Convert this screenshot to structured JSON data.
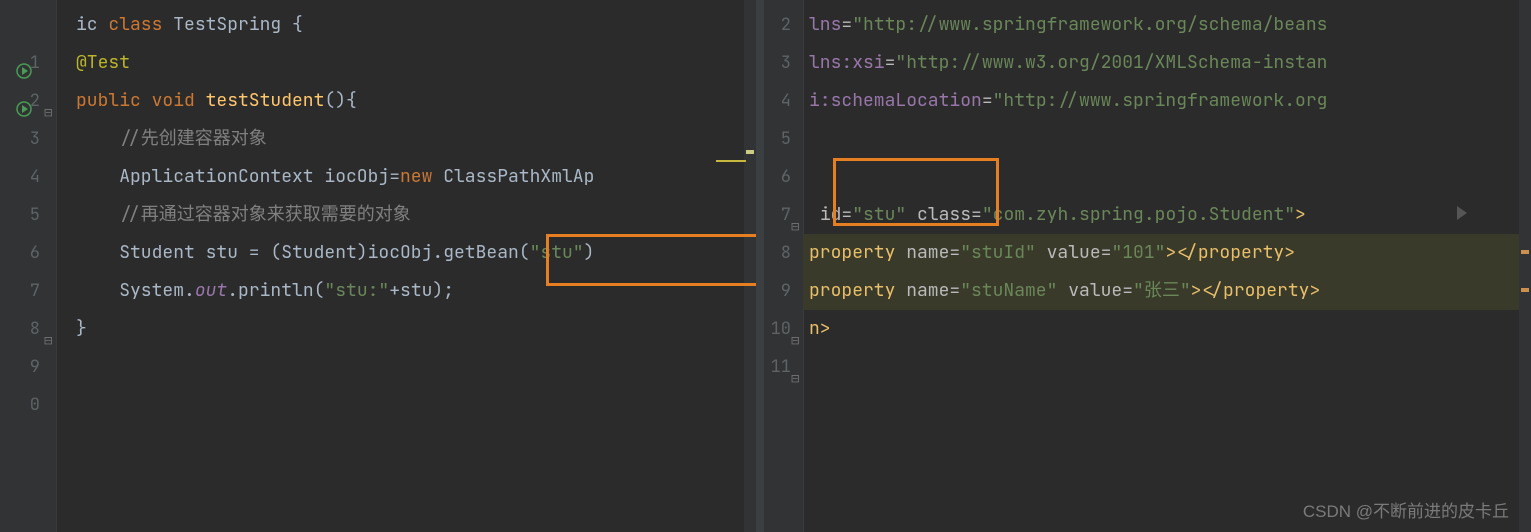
{
  "left": {
    "lines": [
      {
        "n": "",
        "segs": [
          [
            "id",
            "ic "
          ],
          [
            "kw",
            "class "
          ],
          [
            "id",
            "TestSpring {"
          ]
        ]
      },
      {
        "n": "1",
        "run": true,
        "segs": [
          [
            "ann",
            "@Test"
          ]
        ]
      },
      {
        "n": "2",
        "run": true,
        "fold": true,
        "segs": [
          [
            "kw",
            "public void "
          ],
          [
            "method",
            "testStudent"
          ],
          [
            "id",
            "(){"
          ]
        ]
      },
      {
        "n": "3",
        "segs": [
          [
            "id",
            "    "
          ],
          [
            "cmt",
            "//先创建容器对象"
          ]
        ]
      },
      {
        "n": "4",
        "segs": [
          [
            "id",
            "    ApplicationContext iocObj="
          ],
          [
            "kw",
            "new "
          ],
          [
            "id",
            "ClassPathXmlAp"
          ]
        ]
      },
      {
        "n": "5",
        "segs": [
          [
            "id",
            "    "
          ],
          [
            "cmt",
            "//再通过容器对象来获取需要的对象"
          ]
        ]
      },
      {
        "n": "6",
        "segs": [
          [
            "id",
            "    Student stu = (Student)iocObj.getBean("
          ],
          [
            "str",
            "\"stu\""
          ],
          [
            "id",
            ")"
          ]
        ]
      },
      {
        "n": "7",
        "segs": [
          [
            "id",
            "    System."
          ],
          [
            "field",
            "out"
          ],
          [
            "id",
            ".println("
          ],
          [
            "str",
            "\"stu:\""
          ],
          [
            "id",
            "+stu);"
          ]
        ]
      },
      {
        "n": "8",
        "fold": true,
        "segs": [
          [
            "id",
            "}"
          ]
        ]
      },
      {
        "n": "9",
        "segs": []
      },
      {
        "n": "0",
        "segs": []
      }
    ]
  },
  "right": {
    "lines": [
      {
        "n": "2",
        "segs": [
          [
            "ns",
            "lns"
          ],
          [
            "attr",
            "="
          ],
          [
            "str",
            "\"http://www.springframework.org/schema/beans"
          ]
        ]
      },
      {
        "n": "3",
        "segs": [
          [
            "ns",
            "lns:xsi"
          ],
          [
            "attr",
            "="
          ],
          [
            "str",
            "\"http://www.w3.org/2001/XMLSchema-instan"
          ]
        ]
      },
      {
        "n": "4",
        "segs": [
          [
            "ns",
            "i:schemaLocation"
          ],
          [
            "attr",
            "="
          ],
          [
            "str",
            "\"http://www.springframework.org"
          ]
        ]
      },
      {
        "n": "5",
        "segs": []
      },
      {
        "n": "6",
        "segs": []
      },
      {
        "n": "7",
        "fold": true,
        "segs": [
          [
            "id",
            " "
          ],
          [
            "attr",
            "id="
          ],
          [
            "str",
            "\"stu\""
          ],
          [
            "id",
            " "
          ],
          [
            "attr",
            "class="
          ],
          [
            "str",
            "\"com.zyh.spring.pojo.Student\""
          ],
          [
            "tag",
            ">"
          ]
        ]
      },
      {
        "n": "8",
        "hl": true,
        "segs": [
          [
            "tag",
            "property "
          ],
          [
            "attr",
            "name="
          ],
          [
            "str",
            "\"stuId\""
          ],
          [
            "id",
            " "
          ],
          [
            "attr",
            "value="
          ],
          [
            "str",
            "\"101\""
          ],
          [
            "tag",
            "></property>"
          ]
        ]
      },
      {
        "n": "9",
        "hl": true,
        "segs": [
          [
            "tag",
            "property "
          ],
          [
            "attr",
            "name="
          ],
          [
            "str",
            "\"stuName\""
          ],
          [
            "id",
            " "
          ],
          [
            "attr",
            "value="
          ],
          [
            "str",
            "\"张三\""
          ],
          [
            "tag",
            "></property>"
          ]
        ]
      },
      {
        "n": "10",
        "fold": true,
        "segs": [
          [
            "tag",
            "n>"
          ]
        ]
      },
      {
        "n": "11",
        "fold": true,
        "segs": []
      }
    ]
  },
  "watermark": "CSDN @不断前进的皮卡丘"
}
